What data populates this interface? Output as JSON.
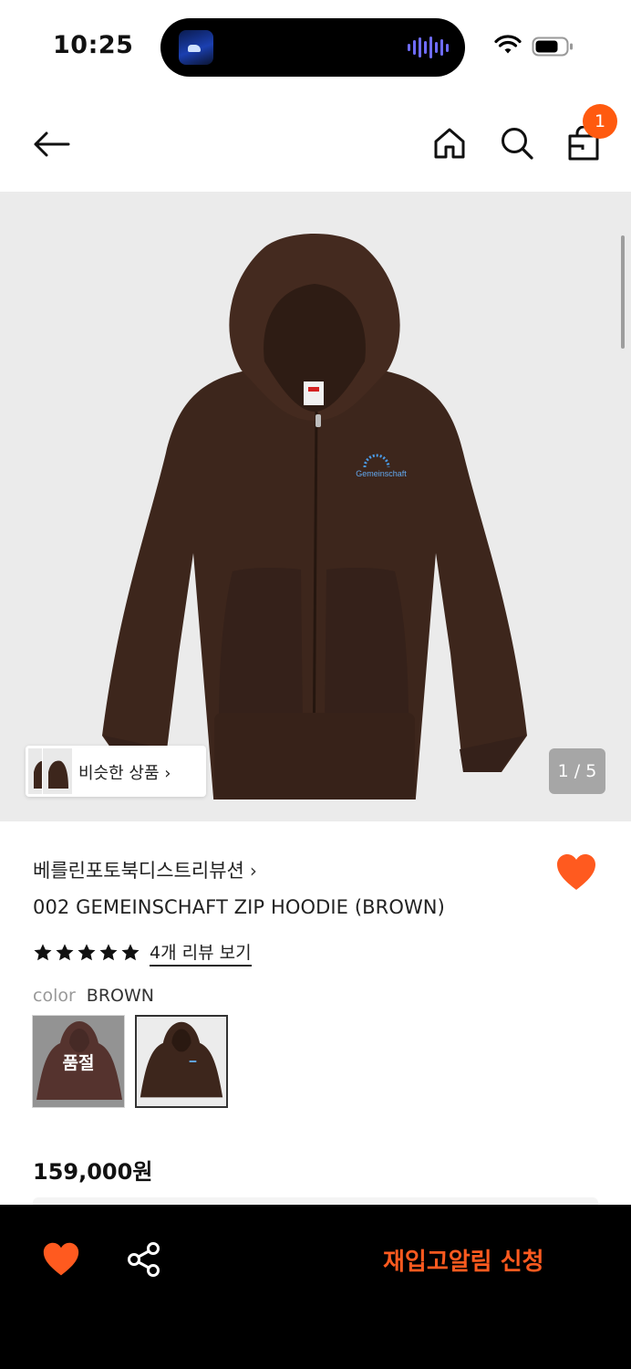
{
  "status_bar": {
    "time": "10:25",
    "wifi_icon": "wifi-icon",
    "battery_icon": "battery-icon"
  },
  "nav": {
    "back_icon": "arrow-left-icon",
    "home_icon": "home-icon",
    "search_icon": "search-icon",
    "cart_icon": "shopping-bag-icon",
    "cart_count": "1"
  },
  "gallery": {
    "similar_label": "비슷한 상품",
    "similar_chevron": "›",
    "counter": "1 / 5",
    "logo_text": "Gemeinschaft"
  },
  "product": {
    "brand": "베를린포토북디스트리뷰션",
    "brand_chevron": "›",
    "title": "002 GEMEINSCHAFT ZIP HOODIE (BROWN)",
    "rating_stars": 5,
    "review_link": "4개 리뷰 보기",
    "color_key": "color",
    "color_value": "BROWN",
    "swatches": [
      {
        "color": "#7a3c34",
        "status": "품절"
      },
      {
        "color": "#3d261c",
        "status": ""
      }
    ],
    "price": "159,000원",
    "wishlisted": true
  },
  "bottom_bar": {
    "heart_icon": "heart-icon",
    "share_icon": "share-icon",
    "cta": "재입고알림 신청"
  },
  "colors": {
    "accent": "#ff5a1f",
    "hoodie_brown": "#3d261c",
    "gallery_bg": "#ebebeb",
    "bottom_bar": "#000000"
  }
}
